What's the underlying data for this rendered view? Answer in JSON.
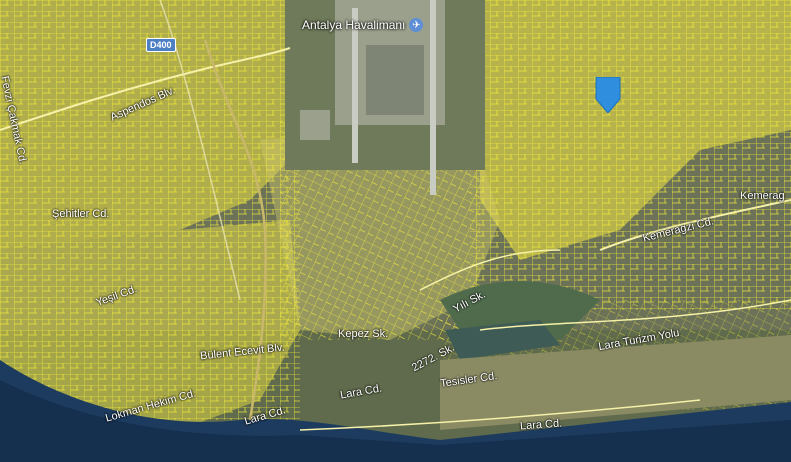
{
  "map": {
    "poi_label": "Antalya Havalimanı",
    "poi_icon": "airplane-icon",
    "road_shield": "D400",
    "marker_icon": "location-pin-icon",
    "marker_color": "#2f8fde",
    "parcel_color": "#f4ec3a",
    "water_color": "#1d3b5e",
    "labels": {
      "kemeragzi": "Kemeragzi Cd.",
      "kemer": "Kemerag",
      "sehitler": "Şehitler Cd.",
      "yesil": "Yeşil Cd.",
      "buhar": "Bülent Ecevit Blv.",
      "yil": "Yılı Sk.",
      "cd2272": "2272. Sk.",
      "tesisler": "Tesisler Cd.",
      "lara": "Lara Cd.",
      "lara2": "Lara Cd.",
      "lara3": "Lara Cd.",
      "lara_turizm": "Lara Turizm Yolu",
      "lokman": "Lokman Hekim Cd.",
      "kepez": "Kepez Sk.",
      "aspendos": "Aspendos Blv.",
      "fevzi": "Fevzi Çakmak Cd."
    }
  }
}
